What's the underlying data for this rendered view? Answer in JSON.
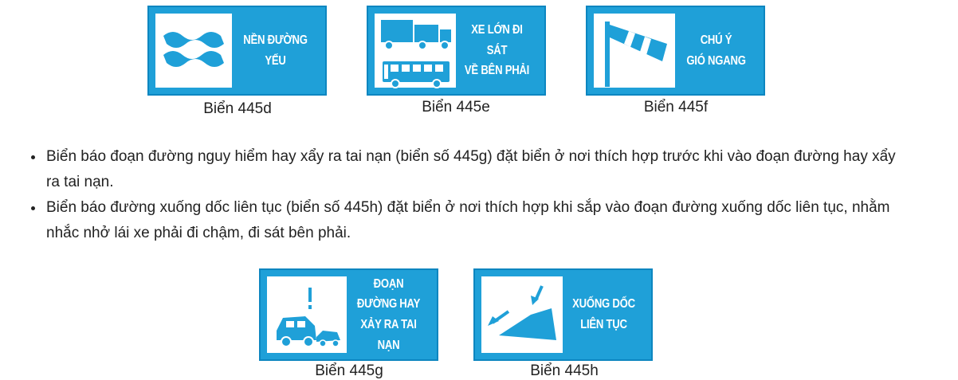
{
  "signs_top": [
    {
      "caption": "Biển 445d",
      "lines": [
        "NỀN ĐƯỜNG YẾU"
      ],
      "icon": "wave-icon"
    },
    {
      "caption": "Biển 445e",
      "lines": [
        "XE LỚN ĐI SÁT",
        "VỀ BÊN PHẢI"
      ],
      "icon": "truck-bus-icon"
    },
    {
      "caption": "Biển 445f",
      "lines": [
        "CHÚ Ý",
        "GIÓ NGANG"
      ],
      "icon": "windsock-icon"
    }
  ],
  "bullets": [
    "Biển báo đoạn đường nguy hiểm hay xẩy ra tai nạn (biển số 445g) đặt biển ở nơi thích hợp trước khi vào đoạn đường hay xẩy ra tai nạn.",
    "Biển báo đường xuống dốc liên tục (biển số 445h) đặt biển ở nơi thích hợp khi sắp vào đoạn đường xuống dốc liên tục, nhằm nhắc nhở lái xe phải đi chậm, đi sát bên phải."
  ],
  "signs_bottom": [
    {
      "caption": "Biển 445g",
      "lines": [
        "ĐOẠN ĐƯỜNG HAY",
        "XẢY RA TAI NẠN"
      ],
      "icon": "car-crash-icon"
    },
    {
      "caption": "Biển 445h",
      "lines": [
        "XUỐNG DỐC",
        "LIÊN TỤC"
      ],
      "icon": "downhill-slope-icon"
    }
  ],
  "colors": {
    "sign_blue": "#1fa0d8",
    "sign_border": "#0d86c0",
    "text": "#222222"
  }
}
